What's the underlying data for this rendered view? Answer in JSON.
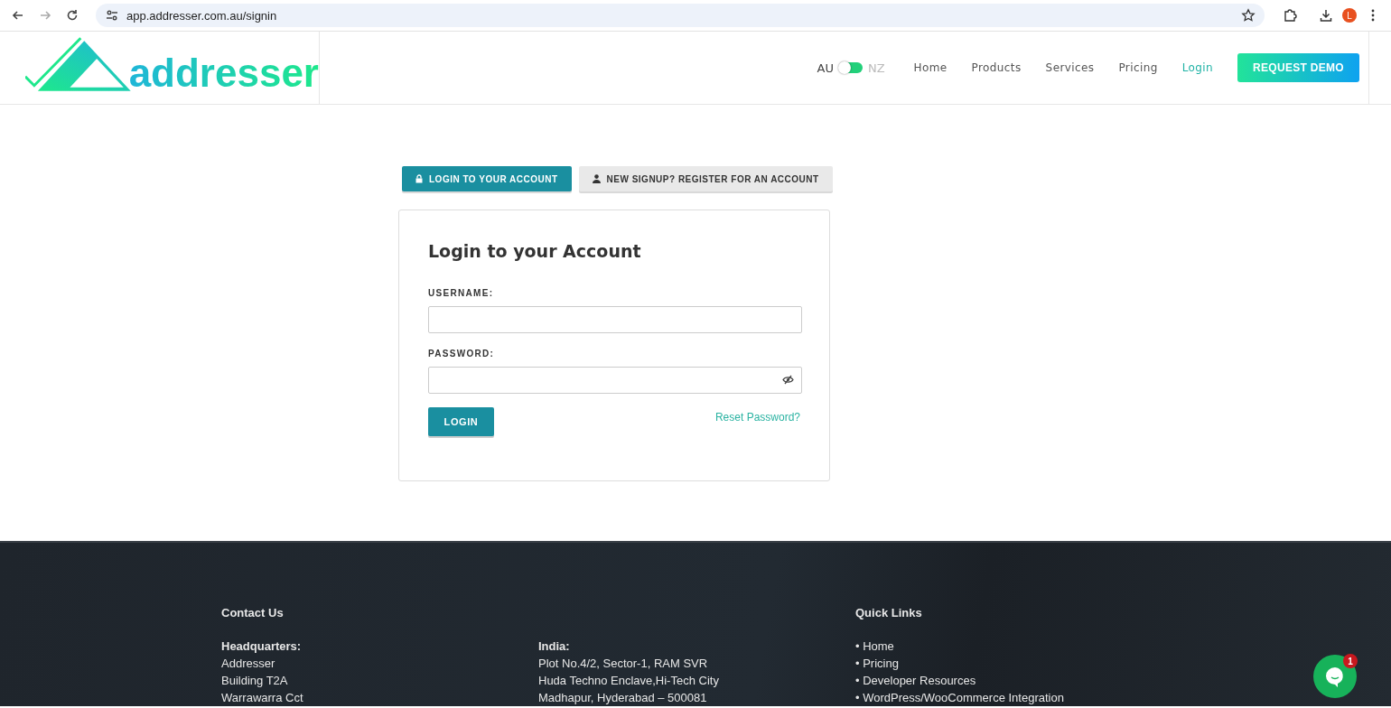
{
  "browser": {
    "url": "app.addresser.com.au/signin",
    "profile_initial": "L"
  },
  "header": {
    "logo_text": "addresser",
    "regions": [
      {
        "label": "AU",
        "selected": true
      },
      {
        "label": "NZ",
        "selected": false
      }
    ],
    "nav": [
      {
        "label": "Home",
        "selected": false
      },
      {
        "label": "Products",
        "selected": false
      },
      {
        "label": "Services",
        "selected": false
      },
      {
        "label": "Pricing",
        "selected": false
      },
      {
        "label": "Login",
        "selected": true
      }
    ],
    "cta": "REQUEST DEMO"
  },
  "tabs": [
    {
      "label": "LOGIN TO YOUR ACCOUNT",
      "selected": true
    },
    {
      "label": "NEW SIGNUP? REGISTER FOR AN ACCOUNT",
      "selected": false
    }
  ],
  "form": {
    "title": "Login to your Account",
    "username_label": "USERNAME:",
    "password_label": "PASSWORD:",
    "submit": "LOGIN",
    "reset_link": "Reset Password?"
  },
  "footer": {
    "columns": [
      {
        "heading": "Contact Us",
        "subheading": "Headquarters:",
        "lines": [
          "Addresser",
          "Building T2A",
          "Warrawarra Cct"
        ]
      },
      {
        "subheading": "India:",
        "lines": [
          "Plot No.4/2, Sector-1, RAM SVR",
          "Huda Techno Enclave,Hi-Tech City",
          "Madhapur, Hyderabad – 500081"
        ]
      },
      {
        "heading": "Quick Links",
        "links": [
          "• Home",
          "• Pricing",
          "• Developer Resources",
          "• WordPress/WooCommerce Integration"
        ]
      }
    ]
  },
  "chat": {
    "badge": "1"
  }
}
